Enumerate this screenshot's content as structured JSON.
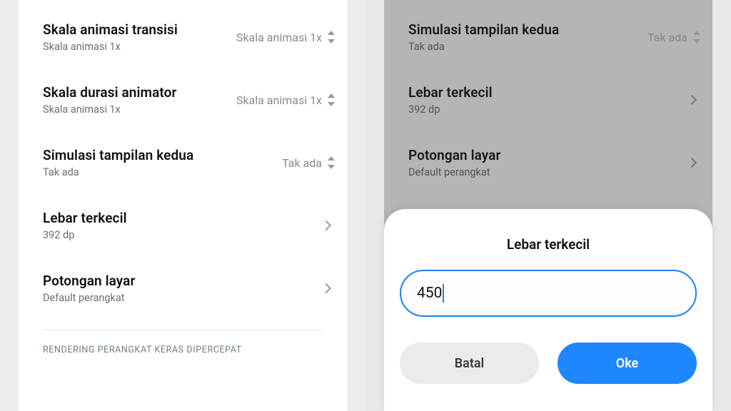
{
  "left": {
    "items": [
      {
        "title": "Skala animasi transisi",
        "sub": "Skala animasi 1x",
        "value": "Skala animasi 1x",
        "ctrl": "updown"
      },
      {
        "title": "Skala durasi animator",
        "sub": "Skala animasi 1x",
        "value": "Skala animasi 1x",
        "ctrl": "updown"
      },
      {
        "title": "Simulasi tampilan kedua",
        "sub": "Tak ada",
        "value": "Tak ada",
        "ctrl": "updown"
      },
      {
        "title": "Lebar terkecil",
        "sub": "392 dp",
        "value": "",
        "ctrl": "chev"
      },
      {
        "title": "Potongan layar",
        "sub": "Default perangkat",
        "value": "",
        "ctrl": "chev"
      }
    ],
    "section_header": "RENDERING PERANGKAT KERAS DIPERCEPAT"
  },
  "right": {
    "items": [
      {
        "title": "Simulasi tampilan kedua",
        "sub": "Tak ada",
        "value": "Tak ada",
        "ctrl": "updown"
      },
      {
        "title": "Lebar terkecil",
        "sub": "392 dp",
        "value": "",
        "ctrl": "chev"
      },
      {
        "title": "Potongan layar",
        "sub": "Default perangkat",
        "value": "",
        "ctrl": "chev"
      }
    ]
  },
  "dialog": {
    "title": "Lebar terkecil",
    "input_value": "450",
    "cancel": "Batal",
    "ok": "Oke"
  }
}
